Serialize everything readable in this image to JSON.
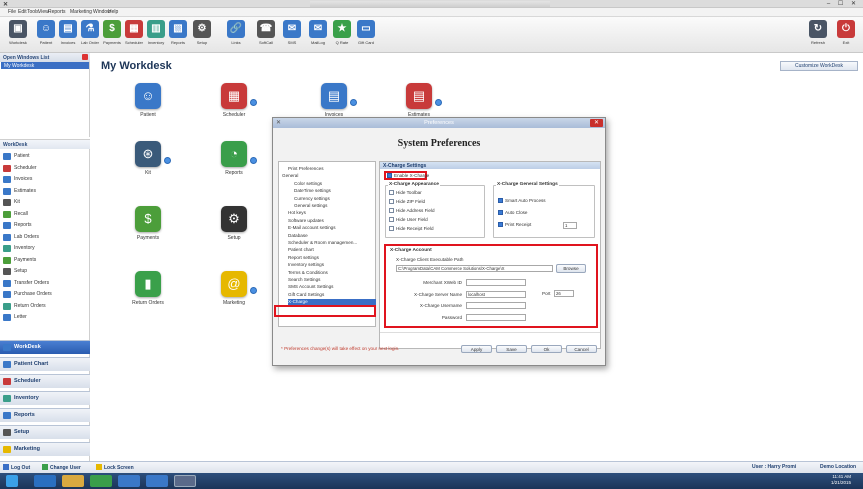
{
  "titlebar": {
    "app_icon": "app-logo-icon",
    "controls": "– ☐ ✕"
  },
  "menu": [
    "File",
    "Edit",
    "Tools",
    "View",
    "Reports",
    "Marketing",
    "Window",
    "Help"
  ],
  "toolbar": {
    "buttons": [
      {
        "label": "Workdesk",
        "color": "#4a5565",
        "glyph": "▣"
      },
      {
        "label": "Patient",
        "color": "#3a78c8",
        "glyph": "☺"
      },
      {
        "label": "Invoices",
        "color": "#3a78c8",
        "glyph": "▤"
      },
      {
        "label": "Lab Order",
        "color": "#3a78c8",
        "glyph": "⚗"
      },
      {
        "label": "Payments",
        "color": "#4c9e3a",
        "glyph": "$"
      },
      {
        "label": "Scheduler",
        "color": "#c83a3a",
        "glyph": "▦"
      },
      {
        "label": "Inventory",
        "color": "#3a9e8a",
        "glyph": "▥"
      },
      {
        "label": "Reports",
        "color": "#3a78c8",
        "glyph": "▧"
      },
      {
        "label": "Setup",
        "color": "#555",
        "glyph": "⚙"
      },
      {
        "label": "Links",
        "color": "#3a78c8",
        "glyph": "🔗"
      },
      {
        "label": "SoftCall",
        "color": "#555",
        "glyph": "☎"
      },
      {
        "label": "SMS",
        "color": "#3a78c8",
        "glyph": "✉"
      },
      {
        "label": "MailLog",
        "color": "#3a78c8",
        "glyph": "✉"
      },
      {
        "label": "Q Rate",
        "color": "#3aa04a",
        "glyph": "★"
      },
      {
        "label": "Gift Card",
        "color": "#3a78c8",
        "glyph": "▭"
      }
    ],
    "right_buttons": [
      {
        "label": "Refresh",
        "color": "#4a5565",
        "glyph": "↻"
      },
      {
        "label": "Exit",
        "color": "#c83a3a",
        "glyph": "⏻"
      }
    ]
  },
  "open_windows": {
    "title": "Open Windows List",
    "items": [
      "My Workdesk"
    ]
  },
  "workdesk_list": {
    "title": "WorkDesk",
    "items": [
      {
        "label": "Patient",
        "color": "#3a78c8"
      },
      {
        "label": "Scheduler",
        "color": "#c83a3a"
      },
      {
        "label": "Invoices",
        "color": "#3a78c8"
      },
      {
        "label": "Estimates",
        "color": "#3a78c8"
      },
      {
        "label": "Kit",
        "color": "#555"
      },
      {
        "label": "Recall",
        "color": "#4c9e3a"
      },
      {
        "label": "Reports",
        "color": "#3a78c8"
      },
      {
        "label": "Lab Orders",
        "color": "#3a78c8"
      },
      {
        "label": "Inventory",
        "color": "#3a9e8a"
      },
      {
        "label": "Payments",
        "color": "#4c9e3a"
      },
      {
        "label": "Setup",
        "color": "#555"
      },
      {
        "label": "Transfer Orders",
        "color": "#3a78c8"
      },
      {
        "label": "Purchase Orders",
        "color": "#3a78c8"
      },
      {
        "label": "Return Orders",
        "color": "#3a9e8a"
      },
      {
        "label": "Letter",
        "color": "#3a78c8"
      }
    ]
  },
  "nav_sections": [
    "WorkDesk",
    "Patient Chart",
    "Scheduler",
    "Inventory",
    "Reports",
    "Setup",
    "Marketing"
  ],
  "main": {
    "title": "My Workdesk",
    "customize_label": "Customize WorkDesk",
    "icons": [
      {
        "label": "Patient",
        "color": "#3a78c8",
        "glyph": "☺"
      },
      {
        "label": "Scheduler",
        "color": "#c83a3a",
        "glyph": "▦"
      },
      {
        "label": "Invoices",
        "color": "#3a78c8",
        "glyph": "▤"
      },
      {
        "label": "Estimates",
        "color": "#c83a3a",
        "glyph": "▤"
      },
      {
        "label": "Kit",
        "color": "#3a5a7a",
        "glyph": "⊛"
      },
      {
        "label": "Reports",
        "color": "#3a9e4a",
        "glyph": "◔"
      },
      {
        "label": "Payments",
        "color": "#4c9e3a",
        "glyph": "$"
      },
      {
        "label": "Setup",
        "color": "#333",
        "glyph": "⚙"
      },
      {
        "label": "Return Orders",
        "color": "#3aa04a",
        "glyph": "▮"
      },
      {
        "label": "Marketing",
        "color": "#e6b800",
        "glyph": "@"
      }
    ]
  },
  "dialog": {
    "title": "Preferences",
    "header": "System Preferences",
    "tree": [
      {
        "label": "Print Preferences",
        "indent": 1
      },
      {
        "label": "General",
        "indent": 0
      },
      {
        "label": "Color settings",
        "indent": 2
      },
      {
        "label": "DateTime settings",
        "indent": 2
      },
      {
        "label": "Currency settings",
        "indent": 2
      },
      {
        "label": "General settings",
        "indent": 2
      },
      {
        "label": "Hot keys",
        "indent": 1
      },
      {
        "label": "Software updates",
        "indent": 1
      },
      {
        "label": "E-Mail account settings",
        "indent": 1
      },
      {
        "label": "Database",
        "indent": 1
      },
      {
        "label": "Scheduler & Room managemen...",
        "indent": 1
      },
      {
        "label": "Patient chart",
        "indent": 1
      },
      {
        "label": "Report settings",
        "indent": 1
      },
      {
        "label": "Inventory settings",
        "indent": 1
      },
      {
        "label": "Terms & Conditions",
        "indent": 1
      },
      {
        "label": "Search Settings",
        "indent": 1
      },
      {
        "label": "SMS Account Settings",
        "indent": 1
      },
      {
        "label": "Gift Card Settings",
        "indent": 1
      },
      {
        "label": "X-Charge",
        "indent": 1,
        "selected": true
      }
    ],
    "panel_title": "X-Charge Settings",
    "enable_label": "Enable X-Charge",
    "appearance_title": "X-Charge Appearance",
    "appearance": [
      "Hide Toolbar",
      "Hide ZIP Field",
      "Hide Address Field",
      "Hide User Field",
      "Hide Receipt Field"
    ],
    "general_title": "X-Charge General Settings",
    "general": [
      {
        "label": "Smart Auto Process",
        "checked": true
      },
      {
        "label": "Auto Close",
        "checked": true
      },
      {
        "label": "Print Receipt",
        "checked": true
      }
    ],
    "print_receipt_value": "1",
    "account_title": "X-Charge Account",
    "exe_path_label": "X-Charge Client Executable Path",
    "exe_path": "C:\\ProgramData\\CAM Commerce Solutions\\X-Charge\\X",
    "browse_label": "Browse",
    "fields": [
      {
        "label": "Merchant XWeb ID",
        "value": ""
      },
      {
        "label": "X-Charge Server Name",
        "value": "localhost"
      },
      {
        "label": "X-Charge Username",
        "value": ""
      },
      {
        "label": "Password",
        "value": ""
      }
    ],
    "port_label": "Port",
    "port_value": "26",
    "footnote": "* Preferences change(s) will take effect on your next login.",
    "buttons": [
      "Apply",
      "Save",
      "Ok",
      "Cancel"
    ]
  },
  "status": {
    "logout": "Log Out",
    "change_user": "Change User",
    "lock_screen": "Lock Screen",
    "user": "User : Harry Promi",
    "location": "Demo Location"
  },
  "clock": {
    "time": "11:41 AM",
    "date": "1/21/2015"
  }
}
